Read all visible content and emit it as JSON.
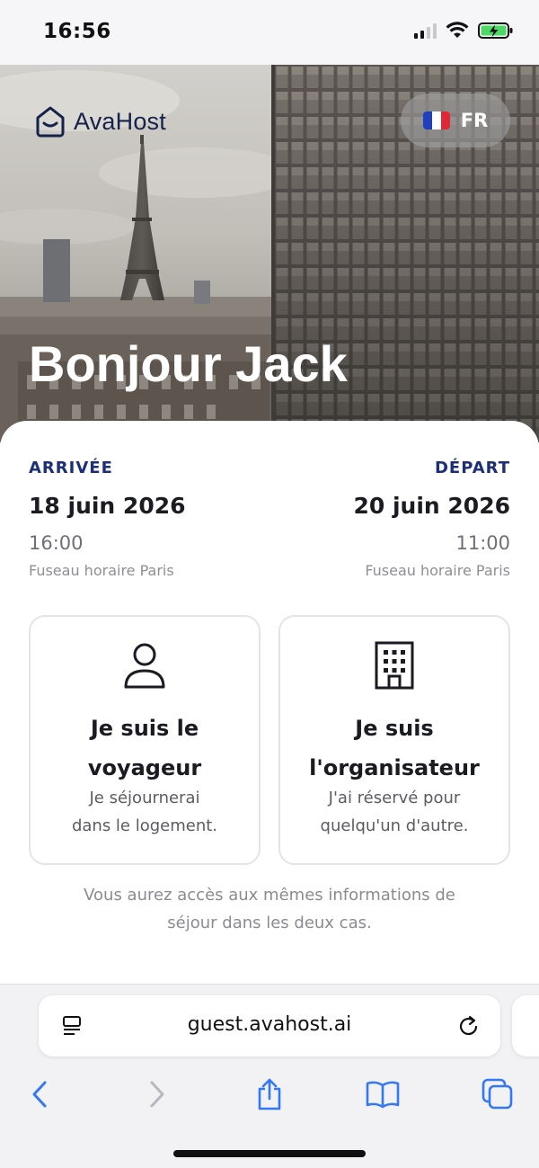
{
  "status_bar": {
    "time": "16:56"
  },
  "hero": {
    "brand_name": "AvaHost",
    "language_code": "FR",
    "greeting": "Bonjour Jack"
  },
  "stay": {
    "arrival": {
      "label": "ARRIVÉE",
      "date": "18 juin 2026",
      "time": "16:00",
      "timezone": "Fuseau horaire Paris"
    },
    "departure": {
      "label": "DÉPART",
      "date": "20 juin 2026",
      "time": "11:00",
      "timezone": "Fuseau horaire Paris"
    }
  },
  "choices": [
    {
      "title_line1": "Je suis le",
      "title_line2": "voyageur",
      "desc_line1": "Je séjournerai",
      "desc_line2": "dans le logement.",
      "icon": "person-icon"
    },
    {
      "title_line1": "Je suis",
      "title_line2": "l'organisateur",
      "desc_line1": "J'ai réservé pour",
      "desc_line2": "quelqu'un d'autre.",
      "icon": "building-icon"
    }
  ],
  "note": {
    "line1": "Vous aurez accès aux mêmes informations de",
    "line2": "séjour dans les deux cas."
  },
  "browser": {
    "url": "guest.avahost.ai"
  },
  "colors": {
    "accent": "#1c2f77",
    "brand": "#17224a",
    "ios_blue": "#3478f6"
  }
}
